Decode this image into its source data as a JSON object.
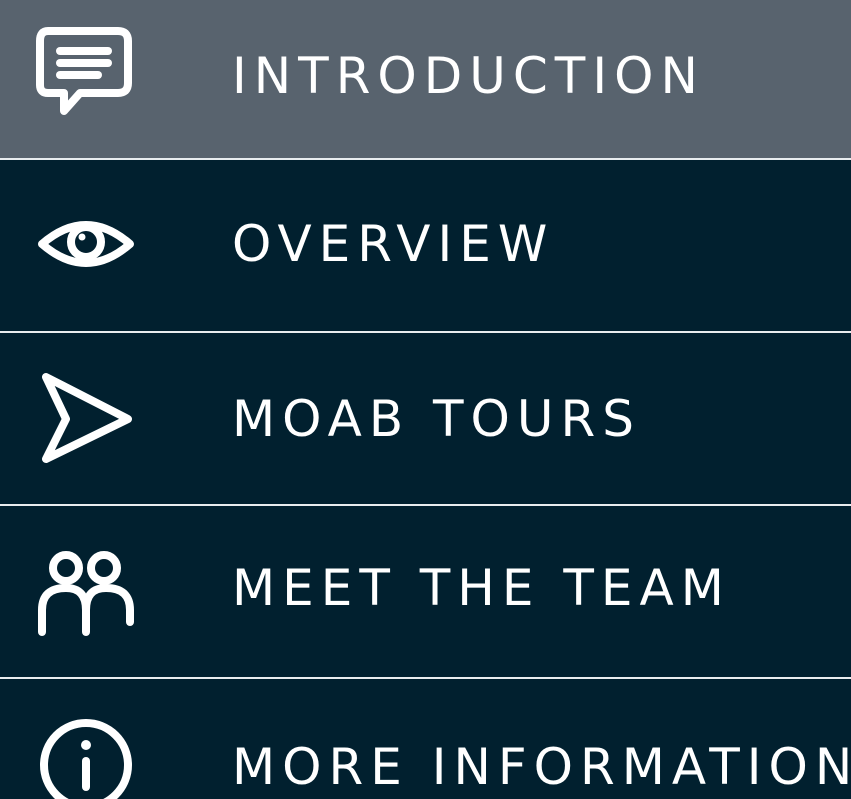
{
  "colors": {
    "active_background": "#58636e",
    "background": "#01202f",
    "divider": "#e8ecef",
    "text": "#ffffff"
  },
  "menu": {
    "items": [
      {
        "label": "INTRODUCTION",
        "icon": "speech-bubble-icon",
        "state": "active"
      },
      {
        "label": "OVERVIEW",
        "icon": "eye-icon",
        "state": "inactive"
      },
      {
        "label": "MOAB TOURS",
        "icon": "paper-plane-icon",
        "state": "inactive"
      },
      {
        "label": "MEET THE TEAM",
        "icon": "people-icon",
        "state": "inactive"
      },
      {
        "label": "MORE INFORMATION",
        "icon": "info-icon",
        "state": "inactive"
      }
    ]
  }
}
